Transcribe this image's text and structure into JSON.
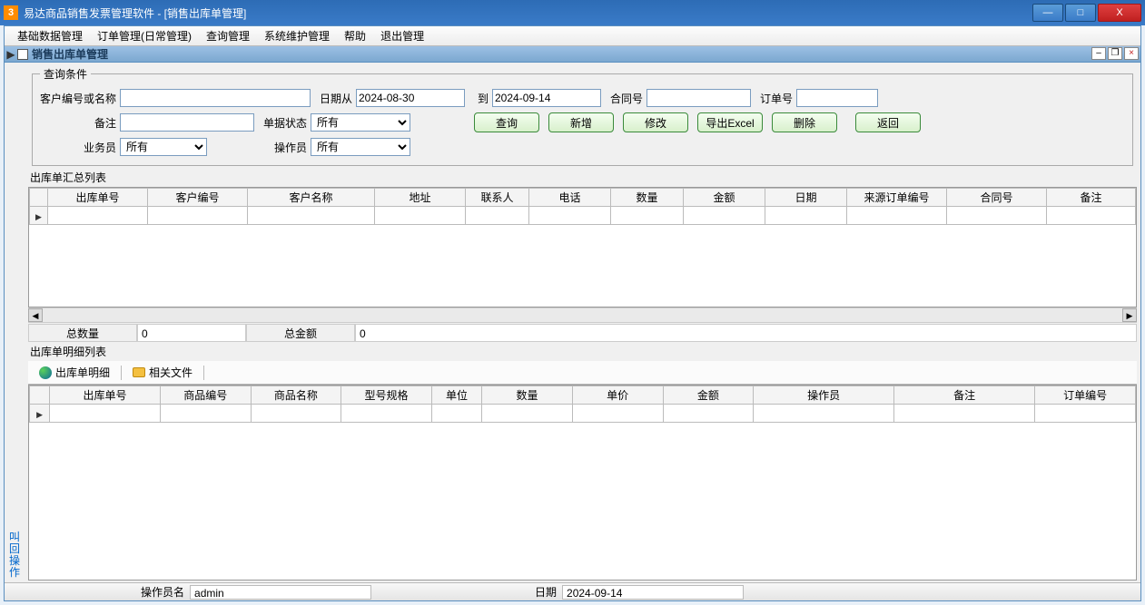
{
  "title": "易达商品销售发票管理软件   - [销售出库单管理]",
  "titleIcon": "3",
  "winControls": {
    "min": "—",
    "max": "□",
    "close": "X"
  },
  "menu": [
    "基础数据管理",
    "订单管理(日常管理)",
    "查询管理",
    "系统维护管理",
    "帮助",
    "退出管理"
  ],
  "subwin": {
    "title": "销售出库单管理",
    "controls": {
      "min": "–",
      "restore": "❐",
      "close": "×"
    }
  },
  "query": {
    "legend": "查询条件",
    "customer_label": "客户编号或名称",
    "customer_value": "",
    "date_from_label": "日期从",
    "date_from": "2024-08-30",
    "date_to_label": "到",
    "date_to": "2024-09-14",
    "contract_label": "合同号",
    "contract_value": "",
    "order_label": "订单号",
    "order_value": "",
    "remark_label": "备注",
    "remark_value": "",
    "status_label": "单据状态",
    "status_value": "所有",
    "salesman_label": "业务员",
    "salesman_value": "所有",
    "operator_label": "操作员",
    "operator_value": "所有"
  },
  "buttons": {
    "search": "查询",
    "new": "新增",
    "edit": "修改",
    "export": "导出Excel",
    "delete": "删除",
    "back": "返回"
  },
  "summary": {
    "label": "出库单汇总列表",
    "columns": [
      "出库单号",
      "客户编号",
      "客户名称",
      "地址",
      "联系人",
      "电话",
      "数量",
      "金额",
      "日期",
      "来源订单编号",
      "合同号",
      "备注"
    ]
  },
  "totals": {
    "qty_label": "总数量",
    "qty_value": "0",
    "amt_label": "总金额",
    "amt_value": "0"
  },
  "detail": {
    "label": "出库单明细列表",
    "tab1": "出库单明细",
    "tab2": "相关文件",
    "columns": [
      "出库单号",
      "商品编号",
      "商品名称",
      "型号规格",
      "单位",
      "数量",
      "单价",
      "金额",
      "操作员",
      "备注",
      "订单编号"
    ]
  },
  "vtab": "叫回操作",
  "status": {
    "operator_label": "操作员名",
    "operator_value": "admin",
    "date_label": "日期",
    "date_value": "2024-09-14"
  }
}
